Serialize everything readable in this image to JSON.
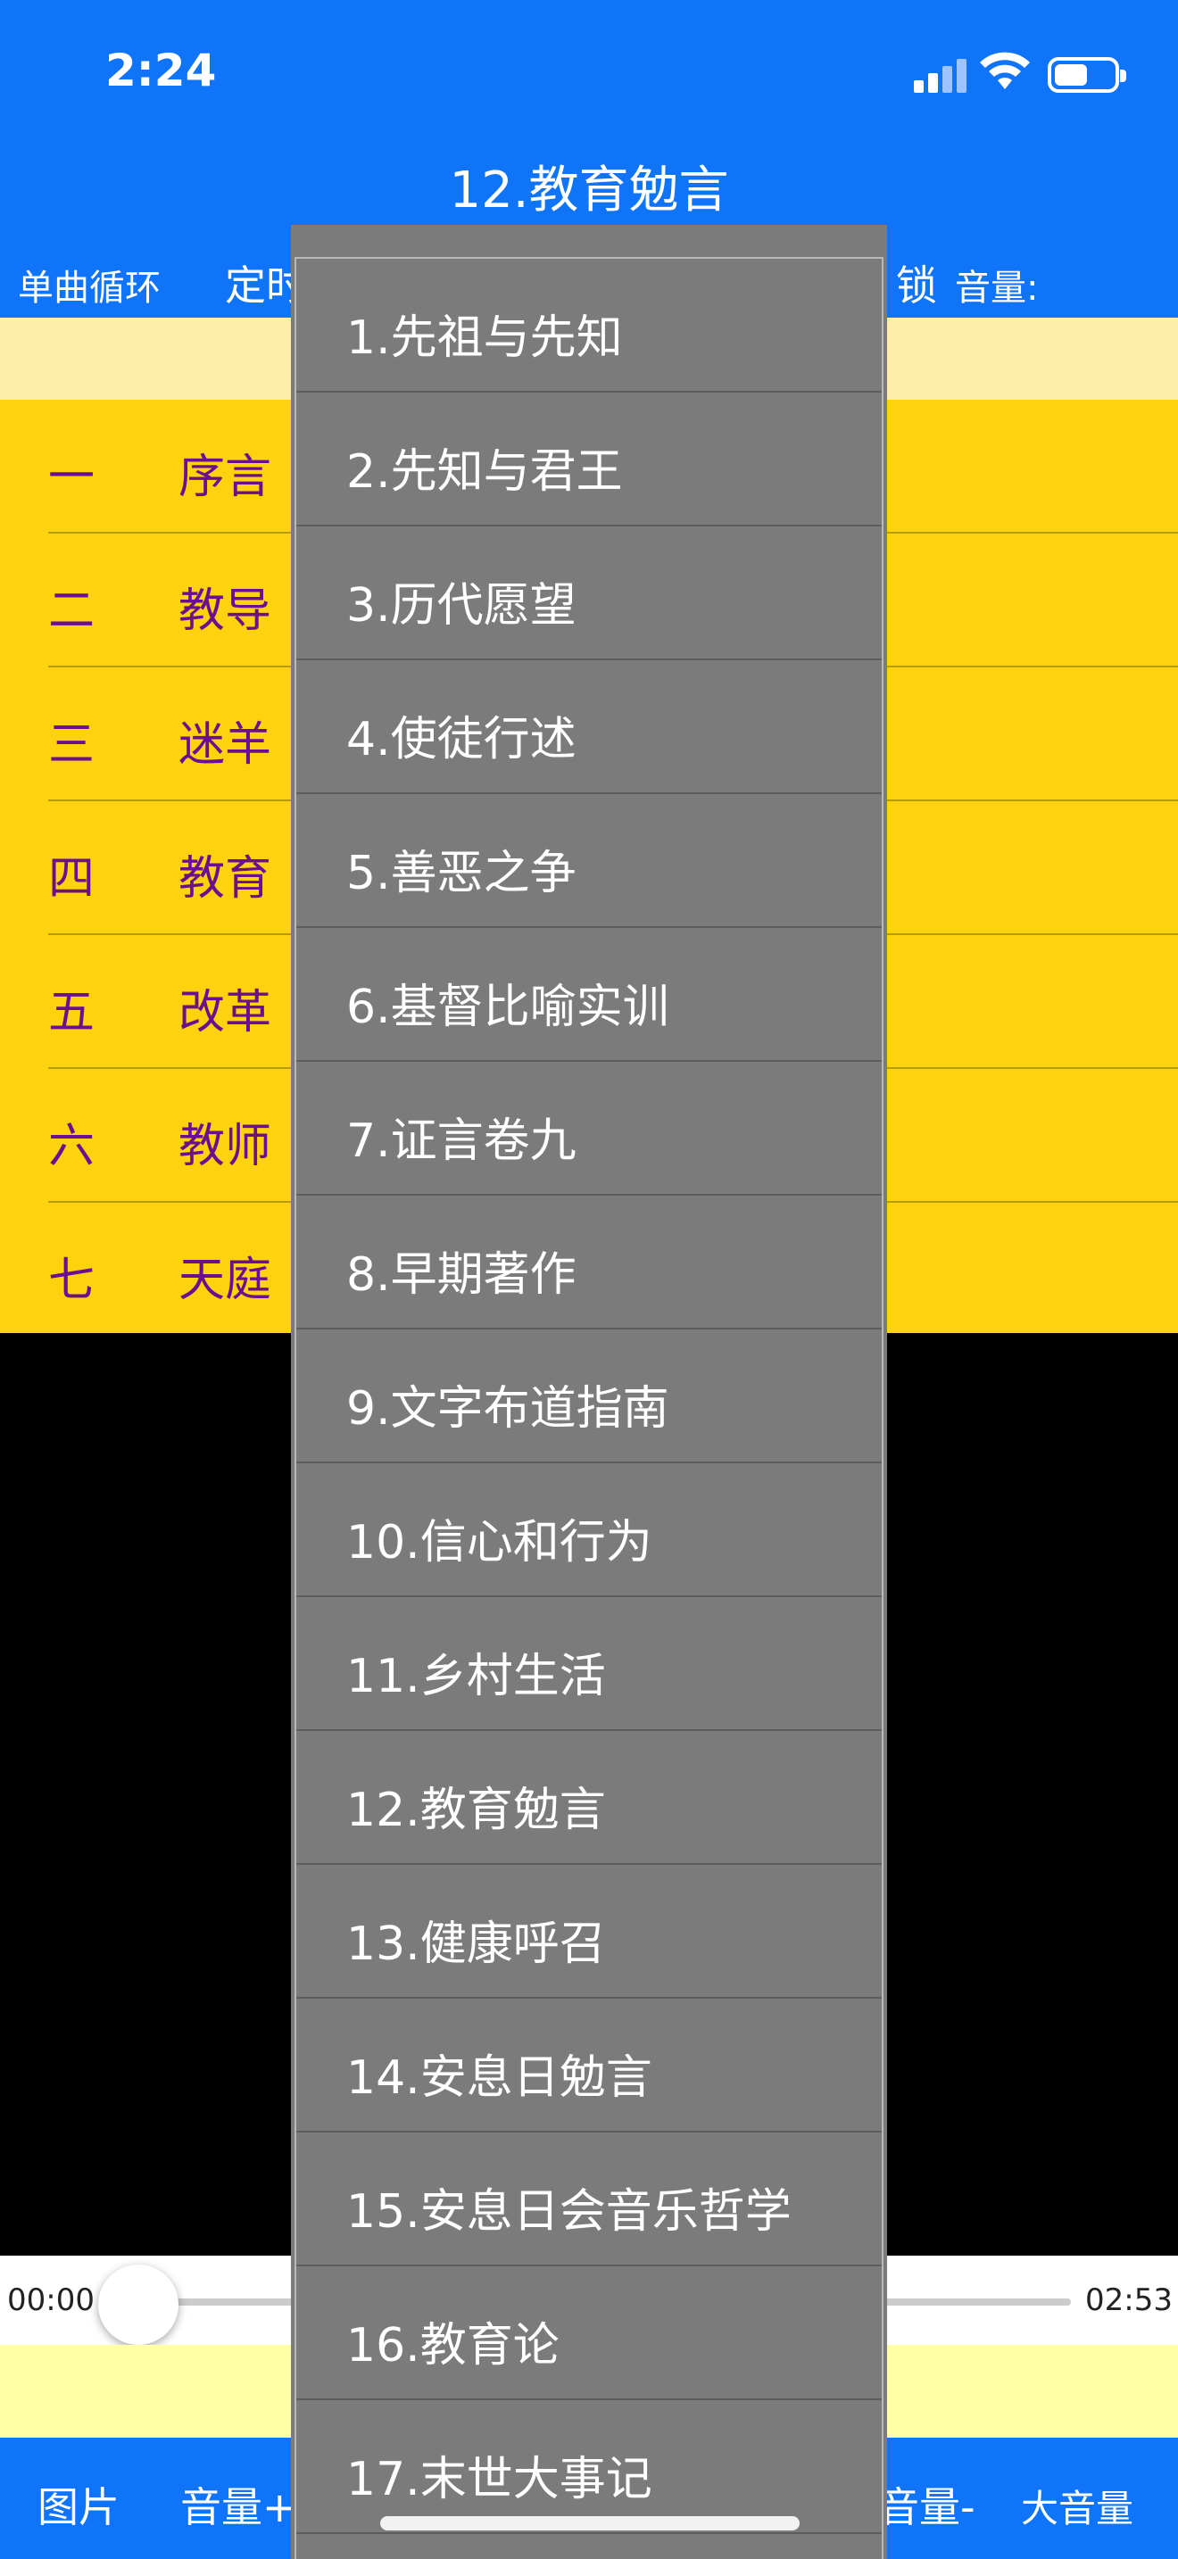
{
  "status_bar": {
    "time": "2:24"
  },
  "header": {
    "title": "12.教育勉言",
    "toolbar": {
      "loop_mode": "单曲循环",
      "timer_partial": "定时",
      "lock_partial": "锁",
      "volume_label": "音量:"
    }
  },
  "chapters": [
    {
      "num": "一",
      "name": "序言"
    },
    {
      "num": "二",
      "name": "教导"
    },
    {
      "num": "三",
      "name": "迷羊"
    },
    {
      "num": "四",
      "name": "教育"
    },
    {
      "num": "五",
      "name": "改革"
    },
    {
      "num": "六",
      "name": "教师"
    },
    {
      "num": "七",
      "name": "天庭"
    }
  ],
  "player": {
    "current_time": "00:00",
    "total_time": "02:53",
    "progress": 0
  },
  "bottom_bar": {
    "image": "图片",
    "volume_up": "音量+",
    "volume_down": "音量-",
    "max_volume": "大音量"
  },
  "book_menu": {
    "items": [
      "1.先祖与先知",
      "2.先知与君王",
      "3.历代愿望",
      "4.使徒行述",
      "5.善恶之争",
      "6.基督比喻实训",
      "7.证言卷九",
      "8.早期著作",
      "9.文字布道指南",
      "10.信心和行为",
      "11.乡村生活",
      "12.教育勉言",
      "13.健康呼召",
      "14.安息日勉言",
      "15.安息日会音乐哲学",
      "16.教育论",
      "17.末世大事记"
    ]
  },
  "colors": {
    "header_blue": "#0f74f7",
    "chapter_yellow": "#fdd20e",
    "chapter_text": "#6a0f8e",
    "menu_gray": "#7b7b7b"
  }
}
